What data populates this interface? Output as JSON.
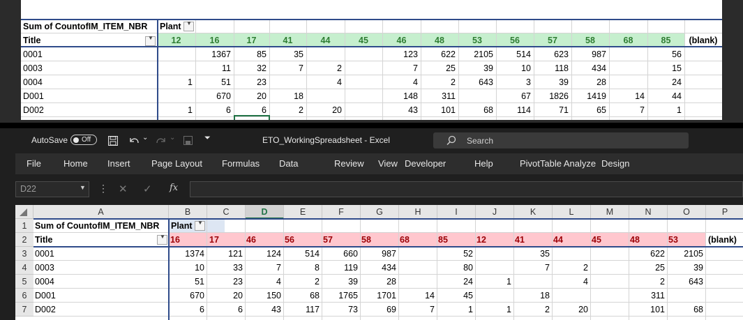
{
  "top_pivot": {
    "header_label": "Sum of CountofIM_ITEM_NBR",
    "plant_label": "Plant",
    "title_label": "Title",
    "columns": [
      "12",
      "16",
      "17",
      "41",
      "44",
      "45",
      "46",
      "48",
      "53",
      "56",
      "57",
      "58",
      "68",
      "85",
      "(blank)"
    ],
    "rows": [
      {
        "title": "0001",
        "values": [
          "",
          "1367",
          "85",
          "35",
          "",
          "",
          "123",
          "622",
          "2105",
          "514",
          "623",
          "987",
          "",
          "56"
        ]
      },
      {
        "title": "0003",
        "values": [
          "",
          "11",
          "32",
          "7",
          "2",
          "",
          "7",
          "25",
          "39",
          "10",
          "118",
          "434",
          "",
          "15"
        ]
      },
      {
        "title": "0004",
        "values": [
          "1",
          "51",
          "23",
          "",
          "4",
          "",
          "4",
          "2",
          "643",
          "3",
          "39",
          "28",
          "",
          "24"
        ]
      },
      {
        "title": "D001",
        "values": [
          "",
          "670",
          "20",
          "18",
          "",
          "",
          "148",
          "311",
          "",
          "67",
          "1826",
          "1419",
          "14",
          "44"
        ]
      },
      {
        "title": "D002",
        "values": [
          "1",
          "6",
          "6",
          "2",
          "20",
          "",
          "43",
          "101",
          "68",
          "114",
          "71",
          "65",
          "7",
          "1"
        ]
      }
    ],
    "header_fill": "#c6efce"
  },
  "window": {
    "autosave_label": "AutoSave",
    "autosave_state": "Off",
    "title": "ETO_WorkingSpreadsheet  -  Excel",
    "search_placeholder": "Search",
    "menu": [
      "File",
      "Home",
      "Insert",
      "Page Layout",
      "Formulas",
      "Data",
      "Review",
      "View",
      "Developer",
      "Help",
      "PivotTable Analyze",
      "Design"
    ],
    "name_box": "D22",
    "fx_label": "fx",
    "column_letters": [
      "A",
      "B",
      "C",
      "D",
      "E",
      "F",
      "G",
      "H",
      "I",
      "J",
      "K",
      "L",
      "M",
      "N",
      "O",
      "P"
    ],
    "row_numbers": [
      "1",
      "2",
      "3",
      "4",
      "5",
      "6",
      "7"
    ]
  },
  "bottom_pivot": {
    "header_label": "Sum of CountofIM_ITEM_NBR",
    "plant_label": "Plant",
    "title_label": "Title",
    "columns": [
      "16",
      "17",
      "46",
      "56",
      "57",
      "58",
      "68",
      "85",
      "12",
      "41",
      "44",
      "45",
      "48",
      "53",
      "(blank)"
    ],
    "rows": [
      {
        "title": "0001",
        "values": [
          "1374",
          "121",
          "124",
          "514",
          "660",
          "987",
          "",
          "52",
          "",
          "35",
          "",
          "",
          "622",
          "2105"
        ]
      },
      {
        "title": "0003",
        "values": [
          "10",
          "33",
          "7",
          "8",
          "119",
          "434",
          "",
          "80",
          "",
          "7",
          "2",
          "",
          "25",
          "39"
        ]
      },
      {
        "title": "0004",
        "values": [
          "51",
          "23",
          "4",
          "2",
          "39",
          "28",
          "",
          "24",
          "1",
          "",
          "4",
          "",
          "2",
          "643"
        ]
      },
      {
        "title": "D001",
        "values": [
          "670",
          "20",
          "150",
          "68",
          "1765",
          "1701",
          "14",
          "45",
          "",
          "18",
          "",
          "",
          "311",
          ""
        ]
      },
      {
        "title": "D002",
        "values": [
          "6",
          "6",
          "43",
          "117",
          "73",
          "69",
          "7",
          "1",
          "1",
          "2",
          "20",
          "",
          "101",
          "68"
        ]
      }
    ],
    "header_fill": "#ffc7ce",
    "header_text_color": "#9c0006"
  }
}
